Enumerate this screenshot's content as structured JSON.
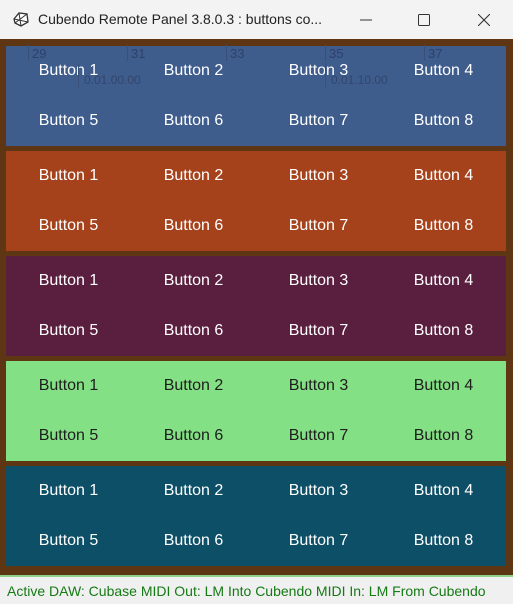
{
  "window": {
    "title": "Cubendo Remote Panel 3.8.0.3 : buttons co...",
    "minimize_glyph": "—",
    "maximize_glyph": "□",
    "close_glyph": "✕",
    "icon": "app-icon"
  },
  "ruler": {
    "bar_numbers": [
      "29",
      "31",
      "33",
      "35",
      "37"
    ],
    "time_labels": [
      "0.01.00.00",
      "0.01.10.00"
    ]
  },
  "groups": [
    {
      "color": "#3e5c8c",
      "text_color": "#ffffff",
      "buttons": [
        "Button 1",
        "Button 2",
        "Button 3",
        "Button 4",
        "Button 5",
        "Button 6",
        "Button 7",
        "Button 8"
      ]
    },
    {
      "color": "#a5421c",
      "text_color": "#ffffff",
      "buttons": [
        "Button 1",
        "Button 2",
        "Button 3",
        "Button 4",
        "Button 5",
        "Button 6",
        "Button 7",
        "Button 8"
      ]
    },
    {
      "color": "#5a1f3f",
      "text_color": "#ffffff",
      "buttons": [
        "Button 1",
        "Button 2",
        "Button 3",
        "Button 4",
        "Button 5",
        "Button 6",
        "Button 7",
        "Button 8"
      ]
    },
    {
      "color": "#84e084",
      "text_color": "#1e1e1e",
      "buttons": [
        "Button 1",
        "Button 2",
        "Button 3",
        "Button 4",
        "Button 5",
        "Button 6",
        "Button 7",
        "Button 8"
      ]
    },
    {
      "color": "#0c4f66",
      "text_color": "#ffffff",
      "buttons": [
        "Button 1",
        "Button 2",
        "Button 3",
        "Button 4",
        "Button 5",
        "Button 6",
        "Button 7",
        "Button 8"
      ]
    }
  ],
  "status": {
    "text": "Active DAW: Cubase  MIDI Out: LM Into Cubendo  MIDI In: LM From Cubendo",
    "color": "#157a15"
  },
  "colors": {
    "panel_background": "#5e3613",
    "titlebar": "#f3f3f3"
  }
}
